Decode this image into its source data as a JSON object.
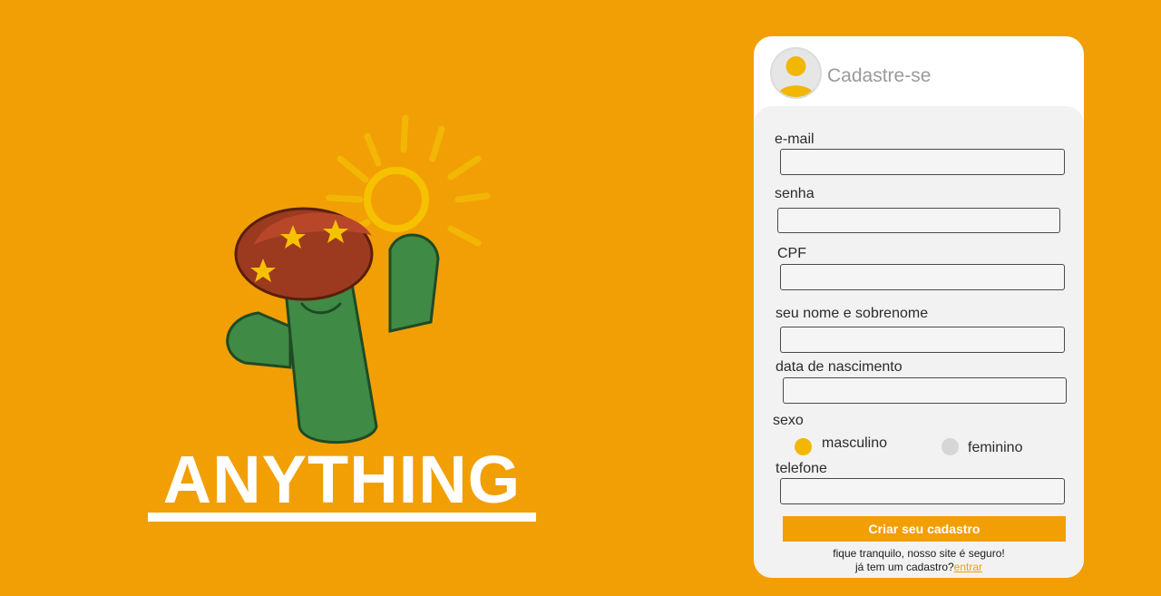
{
  "brand": {
    "name": "ANYTHING"
  },
  "signup": {
    "title": "Cadastre-se",
    "fields": {
      "email_label": "e-mail",
      "password_label": "senha",
      "cpf_label": "CPF",
      "name_label": "seu nome e sobrenome",
      "birth_label": "data de nascimento",
      "sex_label": "sexo",
      "phone_label": "telefone"
    },
    "sex_options": {
      "male": "masculino",
      "female": "feminino",
      "selected": "masculino"
    },
    "submit_label": "Criar seu cadastro",
    "safe_note": "fique tranquilo, nosso site é seguro!",
    "have_account": "já tem um cadastro?",
    "login_link": "entrar"
  },
  "colors": {
    "background": "#f29f05",
    "accent": "#f2b705",
    "card": "#ffffff",
    "card_body": "#f2f2f2"
  },
  "icons": {
    "avatar": "user-avatar-icon",
    "mascot": "cactus-sun-mascot"
  }
}
